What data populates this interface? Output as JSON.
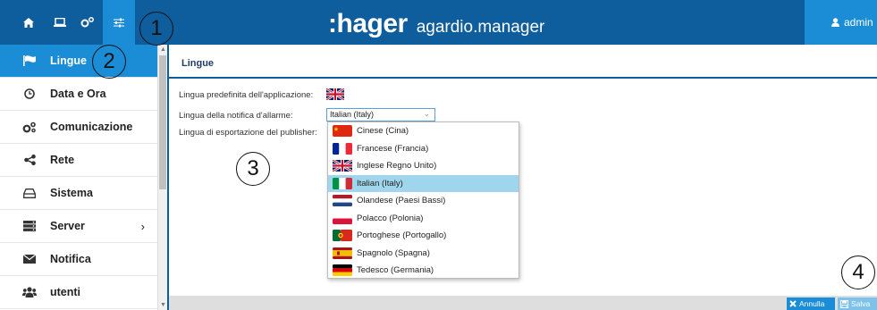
{
  "header": {
    "brand_logo": ":hager",
    "brand_product": "agardio.manager",
    "user_label": "admin",
    "nav_icons": [
      "home-icon",
      "laptop-icon",
      "gears-icon",
      "sliders-icon"
    ]
  },
  "sidebar": {
    "items": [
      {
        "label": "Lingue",
        "icon": "flag-icon",
        "active": true
      },
      {
        "label": "Data e Ora",
        "icon": "clock-icon"
      },
      {
        "label": "Comunicazione",
        "icon": "cogs-icon"
      },
      {
        "label": "Rete",
        "icon": "share-icon"
      },
      {
        "label": "Sistema",
        "icon": "hdd-icon"
      },
      {
        "label": "Server",
        "icon": "server-icon",
        "chevron": "›"
      },
      {
        "label": "Notifica",
        "icon": "envelope-icon"
      },
      {
        "label": "utenti",
        "icon": "users-icon"
      }
    ]
  },
  "main": {
    "title": "Lingue",
    "fields": {
      "app_language_label": "Lingua predefinita dell'applicazione:",
      "alarm_language_label": "Lingua della notifica d'allarme:",
      "alarm_language_value": "Italian (Italy)",
      "publisher_language_label": "Lingua di esportazione del publisher:"
    },
    "dropdown_options": [
      {
        "label": "Cinese (Cina)",
        "flag": "cn"
      },
      {
        "label": "Francese (Francia)",
        "flag": "fr"
      },
      {
        "label": "Inglese Regno Unito)",
        "flag": "uk"
      },
      {
        "label": "Italian (Italy)",
        "flag": "it",
        "selected": true
      },
      {
        "label": "Olandese (Paesi Bassi)",
        "flag": "nl"
      },
      {
        "label": "Polacco (Polonia)",
        "flag": "pl"
      },
      {
        "label": "Portoghese (Portogallo)",
        "flag": "pt"
      },
      {
        "label": "Spagnolo (Spagna)",
        "flag": "es"
      },
      {
        "label": "Tedesco (Germania)",
        "flag": "de"
      }
    ]
  },
  "footer": {
    "cancel_label": "Annulla",
    "save_label": "Salva"
  },
  "callouts": [
    "1",
    "2",
    "3",
    "4"
  ],
  "colors": {
    "brand_blue": "#0e5d9c",
    "accent_blue": "#1a8dd6",
    "selected_option": "#9fd6ee"
  }
}
